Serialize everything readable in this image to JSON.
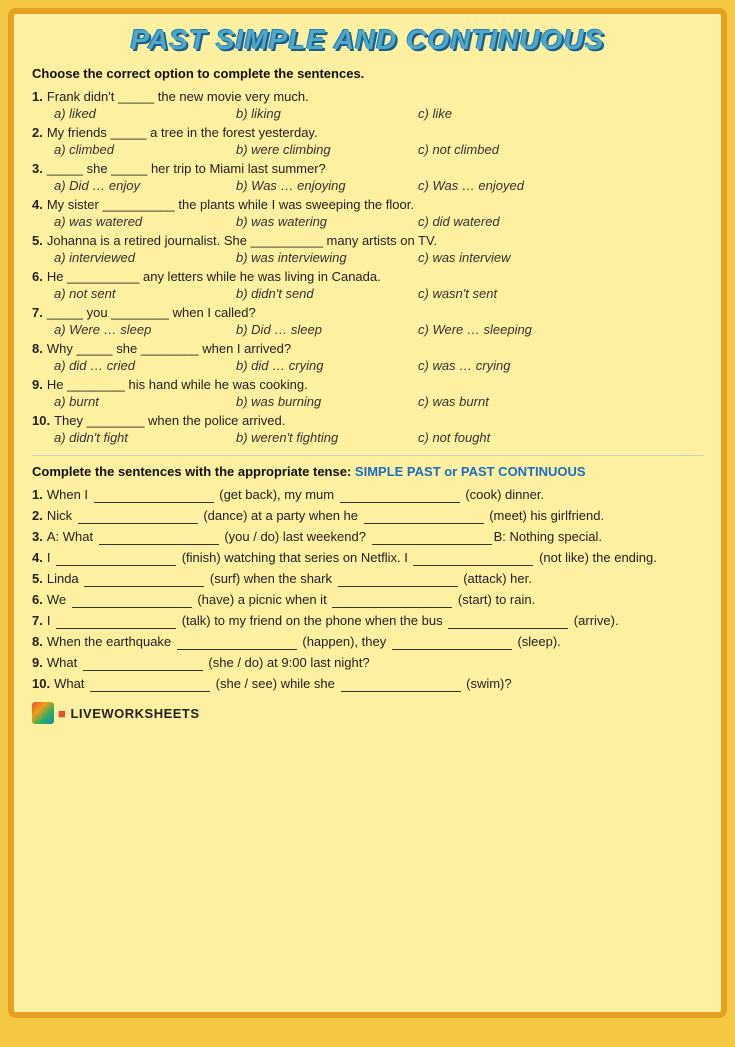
{
  "title": "PAST SIMPLE AND CONTINUOUS",
  "section1": {
    "instruction": "Choose the correct option to complete the sentences.",
    "questions": [
      {
        "num": "1.",
        "text": "Frank didn't _____ the new movie very much.",
        "options": [
          "a)  liked",
          "b)  liking",
          "c)  like"
        ]
      },
      {
        "num": "2.",
        "text": "My friends _____ a tree in the forest yesterday.",
        "options": [
          "a)  climbed",
          "b)  were climbing",
          "c)  not climbed"
        ]
      },
      {
        "num": "3.",
        "text": "_____ she _____ her trip to Miami last summer?",
        "options": [
          "a)  Did … enjoy",
          "b)  Was … enjoying",
          "c)  Was … enjoyed"
        ]
      },
      {
        "num": "4.",
        "text": "My sister __________ the plants while I was sweeping the floor.",
        "options": [
          "a)  was watered",
          "b)  was watering",
          "c)  did watered"
        ]
      },
      {
        "num": "5.",
        "text": "Johanna is a retired journalist. She __________ many artists on TV.",
        "options": [
          "a)  interviewed",
          "b)  was interviewing",
          "c)  was interview"
        ]
      },
      {
        "num": "6.",
        "text": "He __________ any letters while he was living in Canada.",
        "options": [
          "a)  not sent",
          "b)  didn't send",
          "c)  wasn't sent"
        ]
      },
      {
        "num": "7.",
        "text": "_____ you ________ when I called?",
        "options": [
          "a)  Were … sleep",
          "b)  Did … sleep",
          "c)  Were … sleeping"
        ]
      },
      {
        "num": "8.",
        "text": "Why _____ she ________ when I arrived?",
        "options": [
          "a)  did … cried",
          "b)  did … crying",
          "c)  was … crying"
        ]
      },
      {
        "num": "9.",
        "text": "He ________ his hand while he was cooking.",
        "options": [
          "a)  burnt",
          "b)  was burning",
          "c)  was burnt"
        ]
      },
      {
        "num": "10.",
        "text": "They ________ when the police arrived.",
        "options": [
          "a)  didn't fight",
          "b)  weren't fighting",
          "c)  not fought"
        ]
      }
    ]
  },
  "section2": {
    "instruction": "Complete the sentences with the appropriate tense:",
    "instruction_highlight": "SIMPLE PAST or PAST CONTINUOUS",
    "questions": [
      {
        "num": "1.",
        "text_parts": [
          "When I ",
          " (get back), my mum ",
          " (cook) dinner."
        ]
      },
      {
        "num": "2.",
        "text_parts": [
          "Nick ",
          " (dance) at a party when he ",
          " (meet) his girlfriend."
        ]
      },
      {
        "num": "3.",
        "text_parts": [
          "A: What ",
          " (you / do) last weekend?  ",
          "B: Nothing special."
        ]
      },
      {
        "num": "4.",
        "text_parts": [
          "I ",
          " (finish) watching that series on Netflix. I ",
          " (not like) the ending."
        ]
      },
      {
        "num": "5.",
        "text_parts": [
          "Linda ",
          " (surf) when the shark ",
          " (attack) her."
        ]
      },
      {
        "num": "6.",
        "text_parts": [
          "We ",
          " (have) a picnic when it ",
          " (start) to rain."
        ]
      },
      {
        "num": "7.",
        "text_parts": [
          "I ",
          " (talk) to my friend on the phone when the bus ",
          " (arrive)."
        ]
      },
      {
        "num": "8.",
        "text_parts": [
          "When the earthquake ",
          " (happen), they ",
          " (sleep)."
        ]
      },
      {
        "num": "9.",
        "text_parts": [
          "What ",
          " (she / do) at 9:00 last night?"
        ]
      },
      {
        "num": "10.",
        "text_parts": [
          "What ",
          " (she / see) while she ",
          " (swim)?"
        ]
      }
    ]
  },
  "footer": {
    "logo_text": "LIVEWORKSHEETS"
  }
}
